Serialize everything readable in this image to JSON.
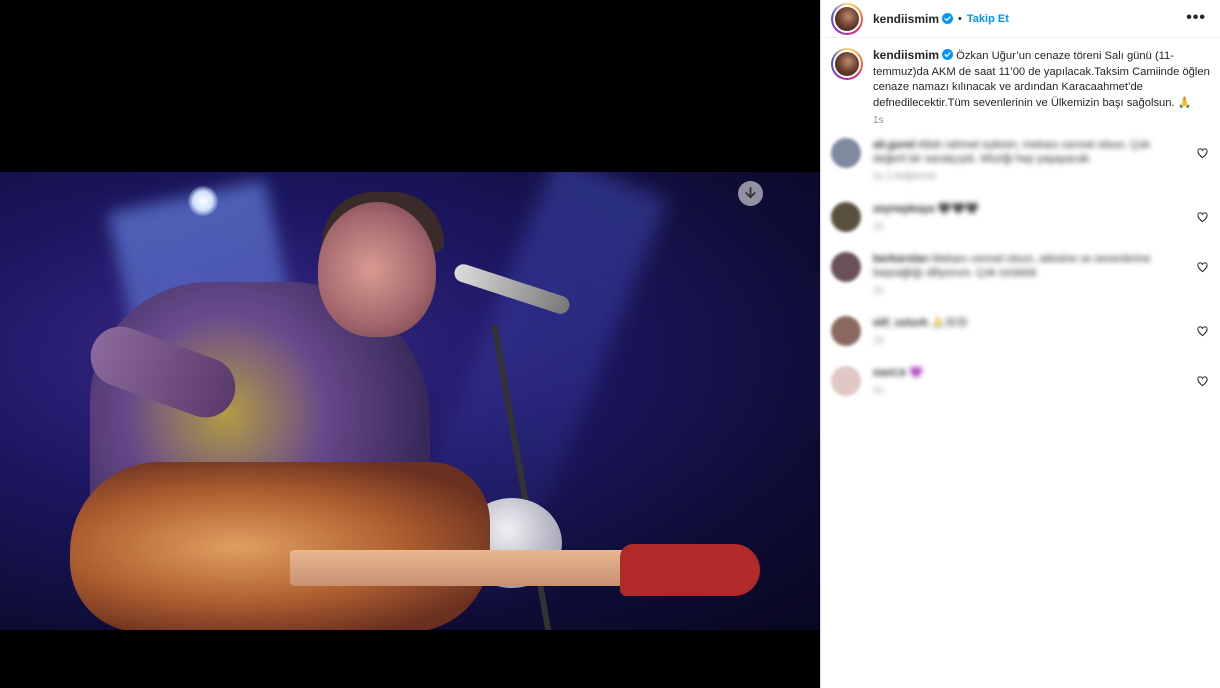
{
  "post": {
    "username": "kendiismim",
    "separator": "•",
    "follow_label": "Takip Et",
    "more_label": "•••",
    "caption": "Özkan Uğur’un cenaze töreni Salı günü (11-temmuz)da AKM de saat 11’00 de yapılacak.Taksim Camiinde öğlen cenaze namazı kılınacak ve ardından Karacaahmet’de defnedilecektir.Tüm sevenlerinin ve Ülkemizin başı sağolsun. 🙏",
    "caption_meta": "1s"
  },
  "media": {
    "download_icon": "download-arrow-icon"
  },
  "comments": [
    {
      "user": "ali.gurel",
      "text": "Allah rahmet eylesin, mekanı cennet olsun. Çok değerli bir sanatçıydı. Müziği hep yaşayacak.",
      "meta": "1s   1 beğenme",
      "avatar_color": "#7f8aa0"
    },
    {
      "user": "zeynepkaya",
      "text": "🖤🖤🖤",
      "meta": "1s",
      "avatar_color": "#5a5040"
    },
    {
      "user": "berkarslan",
      "text": "Mekanı cennet olsun, ailesine ve sevenlerine başsağlığı diliyorum. Çok üzüldük",
      "meta": "1s",
      "avatar_color": "#6a5058"
    },
    {
      "user": "elif_ozturk",
      "text": "🙏😢😢",
      "meta": "1s",
      "avatar_color": "#8a6a60"
    },
    {
      "user": "mert.k",
      "text": "💜",
      "meta": "1s",
      "avatar_color": "#e0c8c4"
    }
  ],
  "colors": {
    "follow_blue": "#0095f6",
    "verified_blue": "#0095f6",
    "meta_gray": "#8e8e8e"
  }
}
